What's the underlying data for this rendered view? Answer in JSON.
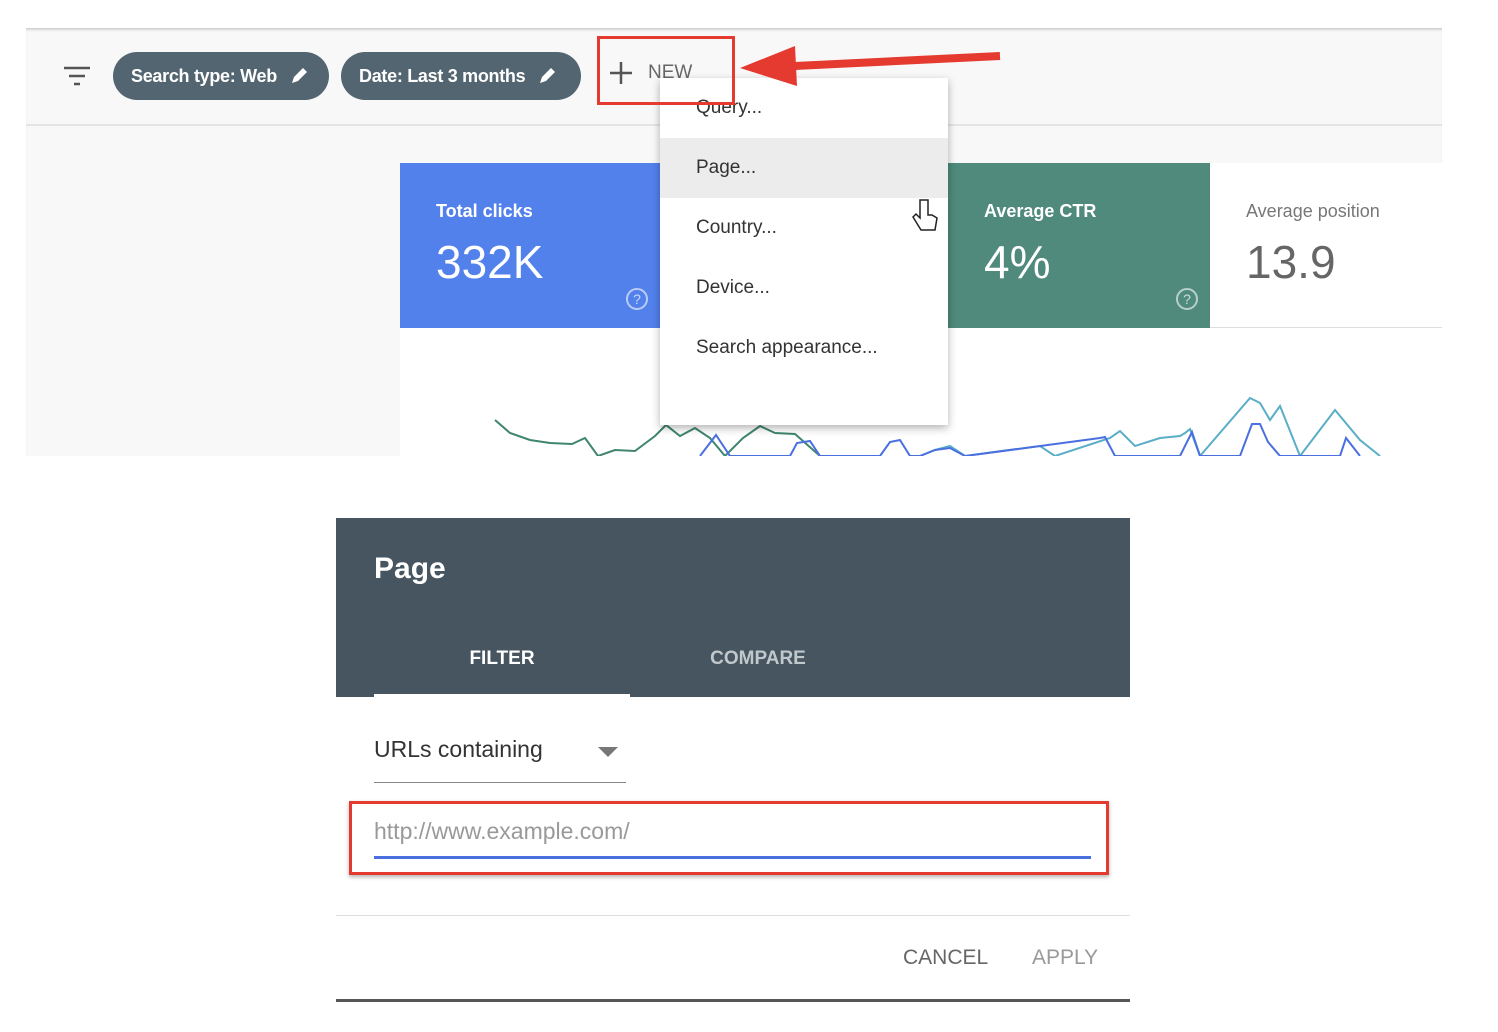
{
  "toolbar": {
    "filter_icon": "filter-list-icon",
    "chips": [
      {
        "label": "Search type: Web",
        "icon": "pencil-icon"
      },
      {
        "label": "Date: Last 3 months",
        "icon": "pencil-icon"
      }
    ],
    "new_label": "NEW",
    "new_icon": "plus-icon"
  },
  "cards": [
    {
      "label": "Total clicks",
      "value": "332K",
      "color": "#5281ec"
    },
    {
      "label": "Average CTR",
      "value": "4%",
      "color": "#4f8a7c"
    },
    {
      "label": "Average position",
      "value": "13.9",
      "color": "#ffffff"
    }
  ],
  "menu": {
    "items": [
      "Query...",
      "Page...",
      "Country...",
      "Device...",
      "Search appearance..."
    ],
    "hovered": "Page..."
  },
  "dialog": {
    "title": "Page",
    "tabs": [
      "FILTER",
      "COMPARE"
    ],
    "active_tab": "FILTER",
    "select_value": "URLs containing",
    "input_placeholder": "http://www.example.com/",
    "cancel": "CANCEL",
    "apply": "APPLY"
  },
  "annotation_color": "#e53a2f"
}
